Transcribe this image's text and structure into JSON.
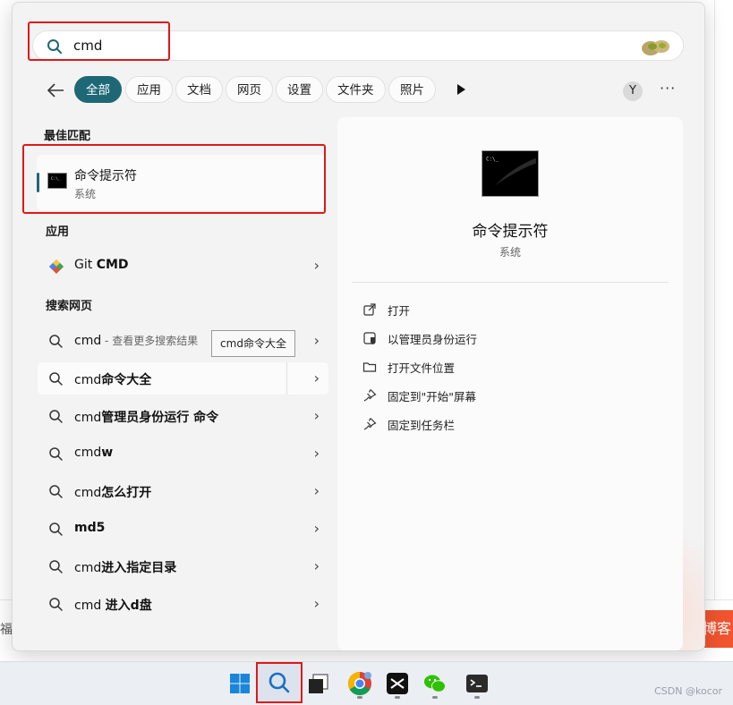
{
  "background": {
    "left_text": "福已",
    "right_badge": "博客"
  },
  "search": {
    "query": "cmd"
  },
  "filters": {
    "chips": [
      "全部",
      "应用",
      "文档",
      "网页",
      "设置",
      "文件夹",
      "照片"
    ],
    "active": "全部",
    "avatar_letter": "Y",
    "more": "···"
  },
  "best_match": {
    "heading": "最佳匹配",
    "title": "命令提示符",
    "subtitle": "系统"
  },
  "apps": {
    "heading": "应用",
    "items": [
      {
        "prefix": "Git ",
        "bold": "CMD"
      }
    ]
  },
  "web": {
    "heading": "搜索网页",
    "first": {
      "text": "cmd",
      "suffix": " - 查看更多搜索结果"
    },
    "tooltip": "cmd命令大全",
    "items": [
      {
        "prefix": "cmd",
        "bold": "命令大全"
      },
      {
        "prefix": "cmd",
        "bold": "管理员身份运行 命令"
      },
      {
        "prefix": "cmd",
        "bold": "w"
      },
      {
        "prefix": "cmd",
        "bold": "怎么打开"
      },
      {
        "prefix": "",
        "bold": "md5"
      },
      {
        "prefix": "cmd",
        "bold": "进入指定目录"
      },
      {
        "prefix": "cmd ",
        "bold": "进入d盘"
      }
    ]
  },
  "preview": {
    "title": "命令提示符",
    "subtitle": "系统",
    "actions": [
      {
        "label": "打开",
        "icon": "open-external-icon"
      },
      {
        "label": "以管理员身份运行",
        "icon": "shield-admin-icon"
      },
      {
        "label": "打开文件位置",
        "icon": "folder-icon"
      },
      {
        "label": "固定到\"开始\"屏幕",
        "icon": "pin-icon"
      },
      {
        "label": "固定到任务栏",
        "icon": "pin-icon"
      }
    ]
  },
  "taskbar": {
    "items": [
      "windows-start-icon",
      "search-icon",
      "task-view-icon",
      "chrome-icon",
      "capcut-icon",
      "wechat-icon",
      "terminal-icon"
    ],
    "watermark": "CSDN @kocor"
  },
  "colors": {
    "accent": "#1e6875",
    "annotation_red": "#e01818",
    "panel_bg": "#f3f3f3"
  }
}
